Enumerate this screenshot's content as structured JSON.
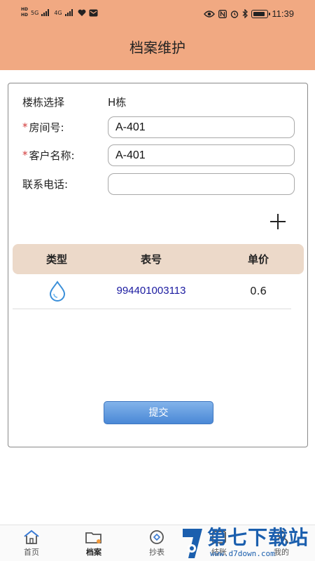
{
  "status_bar": {
    "left_hd_top": "HD",
    "left_hd_bottom": "HD",
    "network_5g": "5G",
    "network_4g": "4G",
    "time": "11:39"
  },
  "header": {
    "title": "档案维护"
  },
  "form": {
    "building": {
      "label": "楼栋选择",
      "value": "H栋"
    },
    "room": {
      "required_mark": "*",
      "label": "房间号:",
      "value": "A-401"
    },
    "customer": {
      "required_mark": "*",
      "label": "客户名称:",
      "value": "A-401"
    },
    "phone": {
      "label": "联系电话:",
      "value": ""
    }
  },
  "table": {
    "headers": [
      "类型",
      "表号",
      "单价"
    ],
    "rows": [
      {
        "type_icon": "water-drop-icon",
        "meter_no": "994401003113",
        "price": "0.6"
      }
    ]
  },
  "submit_label": "提交",
  "tabbar": {
    "items": [
      {
        "label": "首页",
        "icon": "home-icon"
      },
      {
        "label": "档案",
        "icon": "folder-icon"
      },
      {
        "label": "抄表",
        "icon": "meter-read-icon"
      },
      {
        "label": "结账",
        "icon": "checkout-icon"
      },
      {
        "label": "我的",
        "icon": "user-icon"
      }
    ]
  },
  "watermark": {
    "text": "第七下载站",
    "url": "www.d7down.com"
  },
  "colors": {
    "header": "#f1a982",
    "table_header": "#ecd9c9",
    "submit": "#4a88d6",
    "meter_text": "#1a1aa0",
    "required": "#d23a3a"
  }
}
